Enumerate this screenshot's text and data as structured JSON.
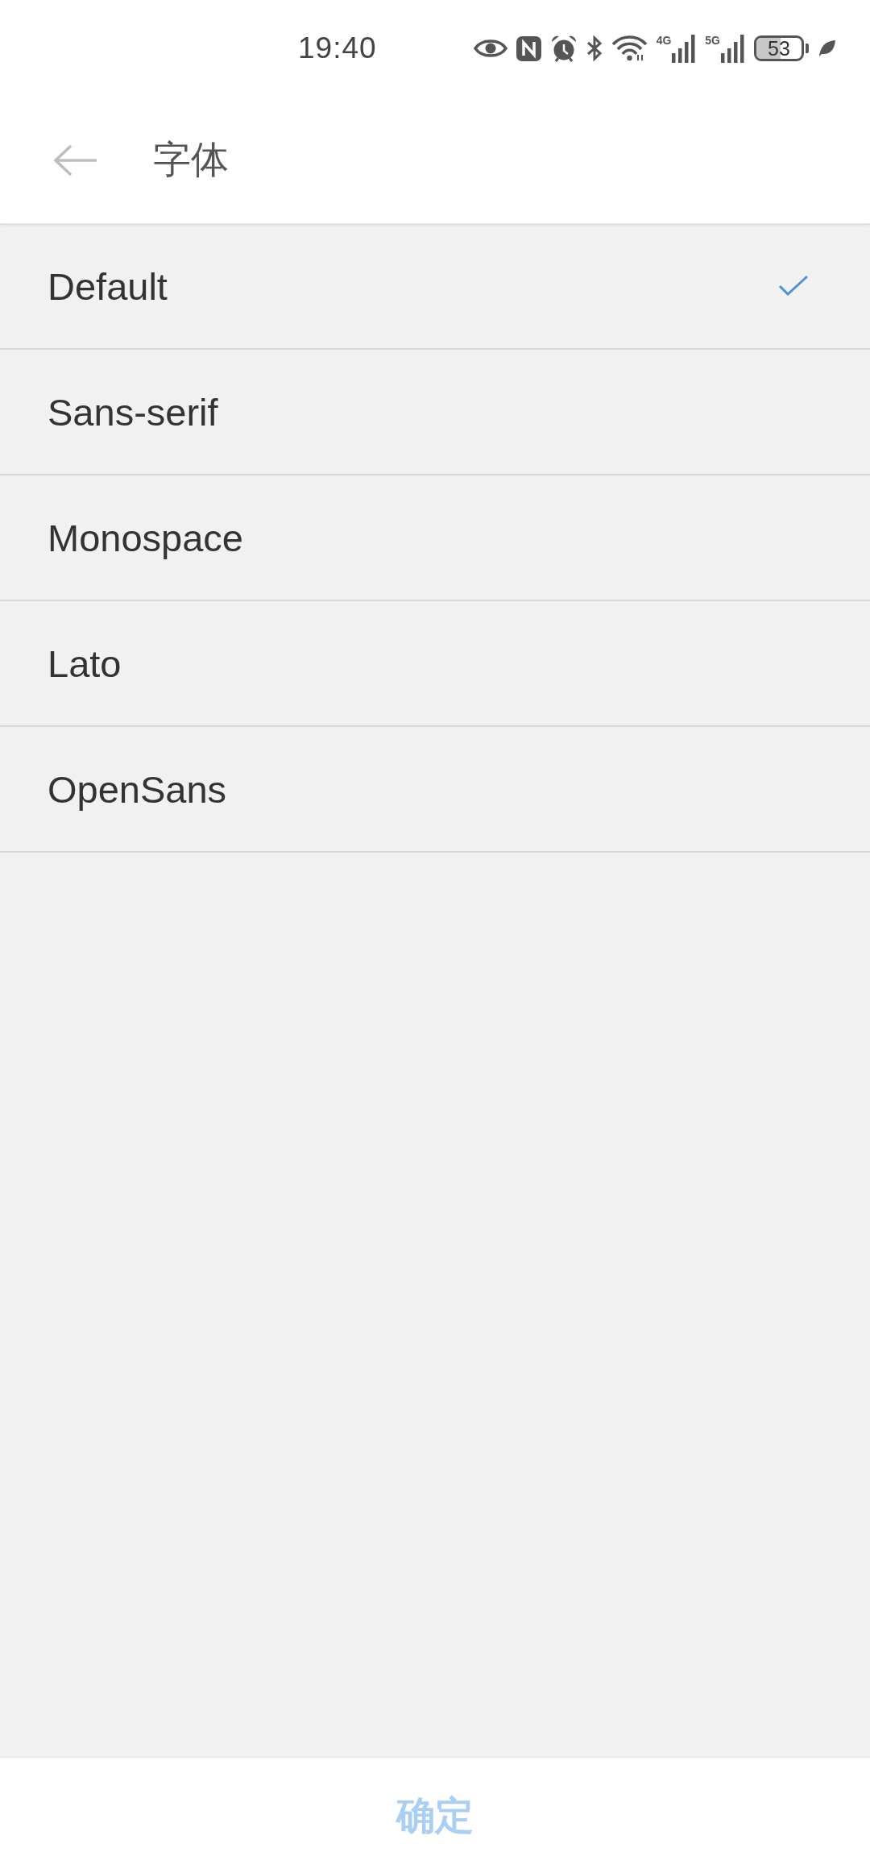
{
  "status_bar": {
    "time": "19:40",
    "network_4g": "4G",
    "network_5g": "5G",
    "battery": "53"
  },
  "header": {
    "title": "字体"
  },
  "fonts": [
    {
      "label": "Default",
      "selected": true
    },
    {
      "label": "Sans-serif",
      "selected": false
    },
    {
      "label": "Monospace",
      "selected": false
    },
    {
      "label": "Lato",
      "selected": false
    },
    {
      "label": "OpenSans",
      "selected": false
    }
  ],
  "confirm_button": {
    "label": "确定",
    "disabled": true
  }
}
